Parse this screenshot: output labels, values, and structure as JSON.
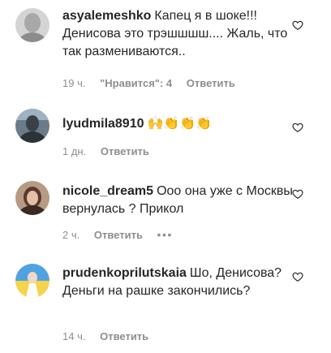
{
  "comments": [
    {
      "username": "asyalemeshko",
      "text": "Капец я в шоке!!! Денисова это трэшшшш.... Жаль, что так размениваются..",
      "time": "19 ч.",
      "likes": "\"Нравится\": 4",
      "reply": "Ответить",
      "avatar_color": "#c7c7c7"
    },
    {
      "username": "lyudmila8910",
      "text": "🙌👏👏👏",
      "time": "1 дн.",
      "reply": "Ответить",
      "avatar_color": "#4a5563"
    },
    {
      "username": "nicole_dream5",
      "text": "Ооо она уже с Москвы вернулась ? Прикол",
      "time": "2 ч.",
      "reply": "Ответить",
      "more": "•••",
      "avatar_color": "#7a5a4b"
    },
    {
      "username": "prudenkoprilutskaia",
      "text": "Шо, Денисова? Деньги на рашке закончились?",
      "time": "14 ч.",
      "reply": "Ответить",
      "avatar_color": "#f2c94c"
    }
  ]
}
